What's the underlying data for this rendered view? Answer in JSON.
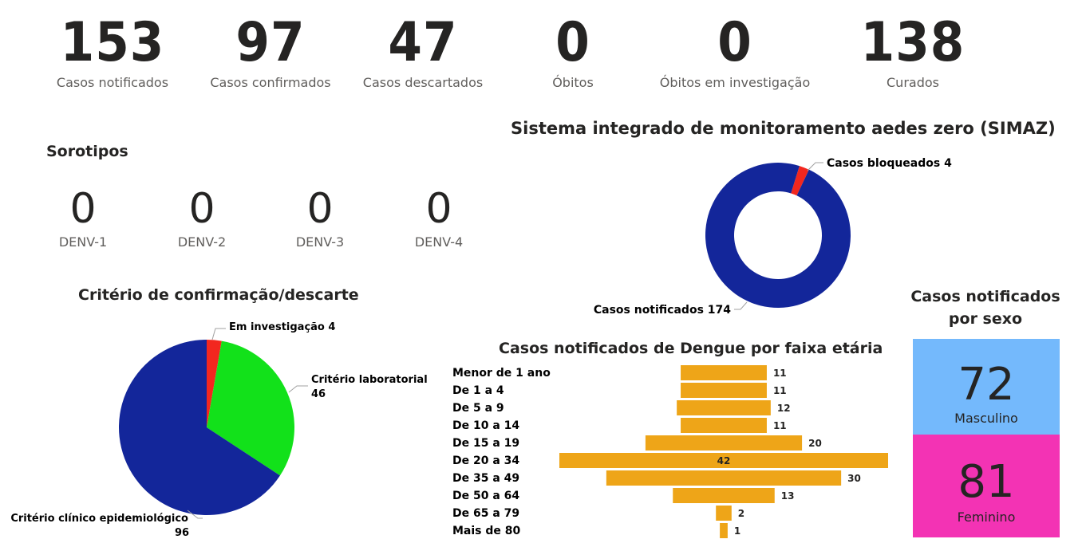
{
  "kpis": [
    {
      "value": "153",
      "label": "Casos notificados"
    },
    {
      "value": "97",
      "label": "Casos confirmados"
    },
    {
      "value": "47",
      "label": "Casos descartados"
    },
    {
      "value": "0",
      "label": "Óbitos"
    },
    {
      "value": "0",
      "label": "Óbitos em investigação"
    },
    {
      "value": "138",
      "label": "Curados"
    }
  ],
  "sorotipos": {
    "title": "Sorotipos",
    "items": [
      {
        "value": "0",
        "label": "DENV-1"
      },
      {
        "value": "0",
        "label": "DENV-2"
      },
      {
        "value": "0",
        "label": "DENV-3"
      },
      {
        "value": "0",
        "label": "DENV-4"
      }
    ]
  },
  "sexo": {
    "title_line1": "Casos notificados",
    "title_line2": "por sexo",
    "masculino": {
      "value": "72",
      "label": "Masculino",
      "color": "#74b9fc"
    },
    "feminino": {
      "value": "81",
      "label": "Feminino",
      "color": "#f333b4"
    }
  },
  "chart_data": [
    {
      "type": "pie",
      "title": "Critério de confirmação/descarte",
      "slices": [
        {
          "label": "Em investigação",
          "value": 4,
          "color": "#f2271f"
        },
        {
          "label": "Critério laboratorial",
          "value": 46,
          "color": "#12e11a"
        },
        {
          "label": "Critério clínico epidemiológico",
          "value": 96,
          "color": "#13269a"
        }
      ]
    },
    {
      "type": "pie",
      "variant": "donut",
      "title": "Sistema integrado de monitoramento aedes zero (SIMAZ)",
      "slices": [
        {
          "label": "Casos bloqueados",
          "value": 4,
          "color": "#f2271f"
        },
        {
          "label": "Casos notificados",
          "value": 174,
          "color": "#13269a"
        }
      ]
    },
    {
      "type": "bar",
      "orientation": "horizontal",
      "layout": "centered",
      "title": "Casos notificados de Dengue por faixa etária",
      "color": "#eea518",
      "categories": [
        "Menor de 1 ano",
        "De 1 a 4",
        "De 5 a 9",
        "De 10 a 14",
        "De 15 a 19",
        "De 20 a 34",
        "De 35 a 49",
        "De 50 a 64",
        "De 65 a 79",
        "Mais de 80"
      ],
      "values": [
        11,
        11,
        12,
        11,
        20,
        42,
        30,
        13,
        2,
        1
      ]
    }
  ]
}
